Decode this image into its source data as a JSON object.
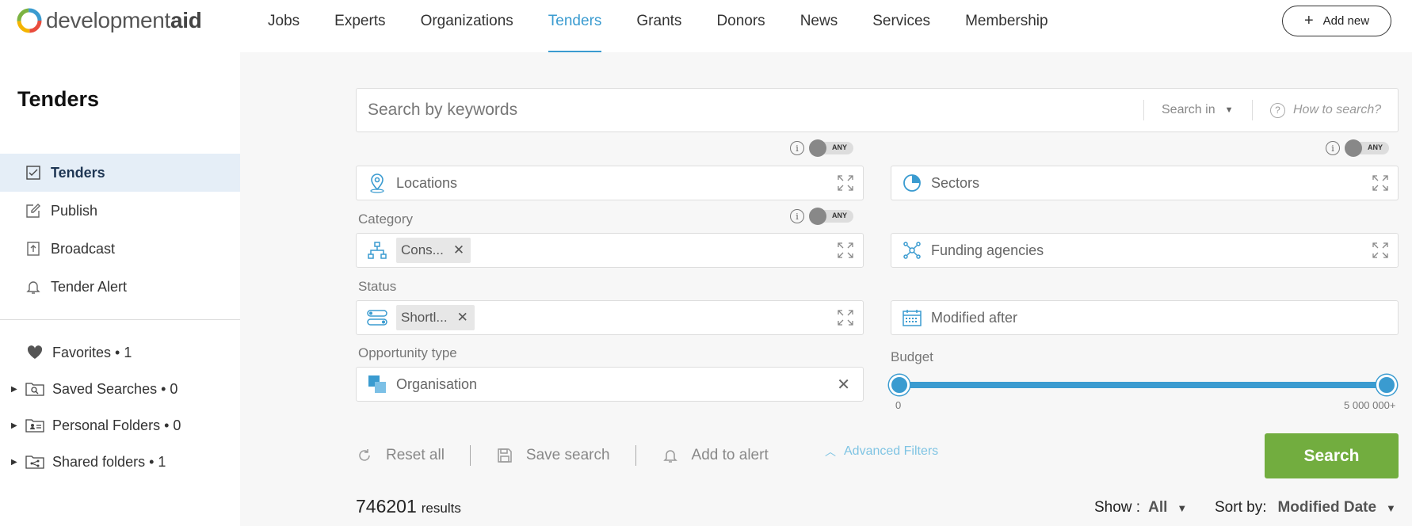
{
  "brand": {
    "name_light": "development",
    "name_bold": "aid"
  },
  "nav": {
    "items": [
      {
        "label": "Jobs",
        "active": false
      },
      {
        "label": "Experts",
        "active": false
      },
      {
        "label": "Organizations",
        "active": false
      },
      {
        "label": "Tenders",
        "active": true
      },
      {
        "label": "Grants",
        "active": false
      },
      {
        "label": "Donors",
        "active": false
      },
      {
        "label": "News",
        "active": false
      },
      {
        "label": "Services",
        "active": false
      },
      {
        "label": "Membership",
        "active": false
      }
    ],
    "add_new": "Add new"
  },
  "sidebar": {
    "title": "Tenders",
    "menu": [
      {
        "label": "Tenders",
        "icon": "checklist-icon",
        "active": true
      },
      {
        "label": "Publish",
        "icon": "edit-icon",
        "active": false
      },
      {
        "label": "Broadcast",
        "icon": "upload-icon",
        "active": false
      },
      {
        "label": "Tender Alert",
        "icon": "bell-icon",
        "active": false
      }
    ],
    "folders": [
      {
        "label": "Favorites • 1",
        "icon": "heart-icon",
        "expandable": false
      },
      {
        "label": "Saved Searches • 0",
        "icon": "search-folder-icon",
        "expandable": true
      },
      {
        "label": "Personal Folders • 0",
        "icon": "person-folder-icon",
        "expandable": true
      },
      {
        "label": "Shared folders • 1",
        "icon": "share-folder-icon",
        "expandable": true
      }
    ]
  },
  "search": {
    "placeholder": "Search by keywords",
    "search_in": "Search in",
    "how_to": "How to search?"
  },
  "toggles": {
    "any_label": "ANY"
  },
  "filters": {
    "locations": {
      "placeholder": "Locations"
    },
    "sectors": {
      "placeholder": "Sectors"
    },
    "category": {
      "label": "Category",
      "chip": "Cons..."
    },
    "funding": {
      "placeholder": "Funding agencies"
    },
    "status": {
      "label": "Status",
      "chip": "Shortl..."
    },
    "modified": {
      "placeholder": "Modified after"
    },
    "opportunity": {
      "label": "Opportunity type",
      "value": "Organisation"
    },
    "budget": {
      "label": "Budget",
      "min_label": "0",
      "max_label": "5 000 000+",
      "range_low": 0,
      "range_high": 1
    }
  },
  "actions": {
    "reset": "Reset all",
    "save": "Save search",
    "alert": "Add to alert",
    "advanced": "Advanced Filters",
    "search_button": "Search"
  },
  "results": {
    "count": "746201",
    "suffix": "results",
    "show_label": "Show :",
    "show_value": "All",
    "sort_label": "Sort by:",
    "sort_value": "Modified Date"
  },
  "colors": {
    "accent": "#3a9bd0",
    "search_button": "#72ad3f",
    "active_bg": "#e5eef7"
  }
}
